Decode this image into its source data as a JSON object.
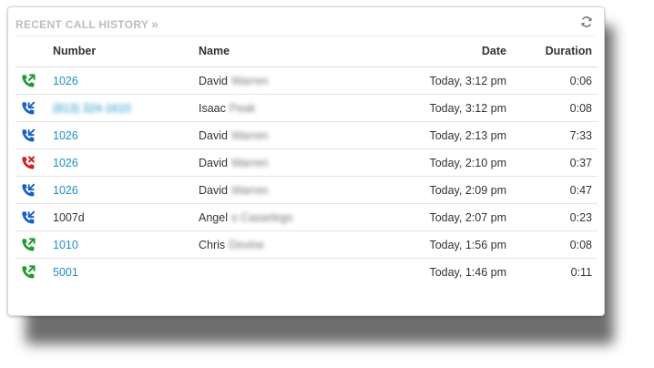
{
  "panel": {
    "title": "RECENT CALL HISTORY",
    "title_chevron": "»",
    "refresh_icon": "refresh-icon"
  },
  "columns": {
    "number": "Number",
    "name": "Name",
    "date": "Date",
    "duration": "Duration"
  },
  "colors": {
    "link": "#1a8fc8",
    "outgoing": "#1e9a2e",
    "incoming": "#1a5fc8",
    "missed": "#d81f1f"
  },
  "calls": [
    {
      "type": "outgoing",
      "icon": "outgoing-call-icon",
      "number": "1026",
      "number_link": true,
      "first_name": "David",
      "last_name": "Warren",
      "date": "Today, 3:12 pm",
      "duration": "0:06"
    },
    {
      "type": "incoming",
      "icon": "incoming-call-icon",
      "number": "(813) 324-1610",
      "number_link": true,
      "number_blurred": true,
      "first_name": "Isaac",
      "last_name": "Peak",
      "date": "Today, 3:12 pm",
      "duration": "0:08"
    },
    {
      "type": "incoming",
      "icon": "incoming-call-icon",
      "number": "1026",
      "number_link": true,
      "first_name": "David",
      "last_name": "Warren",
      "date": "Today, 2:13 pm",
      "duration": "7:33"
    },
    {
      "type": "missed",
      "icon": "missed-call-icon",
      "number": "1026",
      "number_link": true,
      "first_name": "David",
      "last_name": "Warren",
      "date": "Today, 2:10 pm",
      "duration": "0:37"
    },
    {
      "type": "incoming",
      "icon": "incoming-call-icon",
      "number": "1026",
      "number_link": true,
      "first_name": "David",
      "last_name": "Warren",
      "date": "Today, 2:09 pm",
      "duration": "0:47"
    },
    {
      "type": "incoming",
      "icon": "incoming-call-icon",
      "number": "1007d",
      "number_link": false,
      "first_name": "Angel",
      "last_name": "o Casarlego",
      "date": "Today, 2:07 pm",
      "duration": "0:23"
    },
    {
      "type": "outgoing",
      "icon": "outgoing-call-icon",
      "number": "1010",
      "number_link": true,
      "first_name": "Chris",
      "last_name": "Devine",
      "date": "Today, 1:56 pm",
      "duration": "0:08"
    },
    {
      "type": "outgoing",
      "icon": "outgoing-call-icon",
      "number": "5001",
      "number_link": true,
      "first_name": "",
      "last_name": "",
      "date": "Today, 1:46 pm",
      "duration": "0:11"
    }
  ]
}
